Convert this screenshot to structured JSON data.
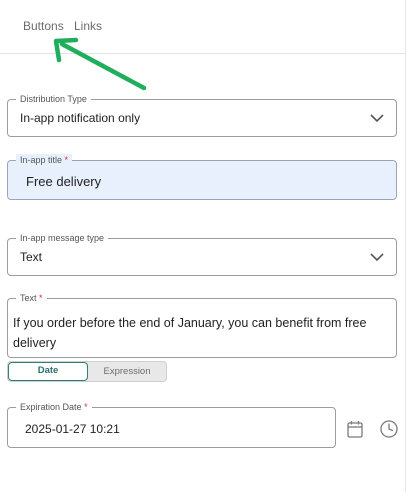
{
  "tabs": [
    {
      "label": "Buttons"
    },
    {
      "label": "Links"
    }
  ],
  "distribution": {
    "label": "Distribution Type",
    "value": "In-app notification only"
  },
  "inapp_title": {
    "label": "In-app title",
    "required_mark": "*",
    "value": "Free delivery"
  },
  "message_type": {
    "label": "In-app message type",
    "value": "Text"
  },
  "text_field": {
    "label": "Text",
    "required_mark": "*",
    "value": "If you order before the end of January, you can benefit from free delivery"
  },
  "mode_toggle": {
    "options": [
      "Date",
      "Expression"
    ],
    "selected": "Date"
  },
  "expiration": {
    "label": "Expiration Date",
    "required_mark": "*",
    "value": "2025-01-27 10:21"
  },
  "icons": {
    "dropdown": "chevron-down-icon",
    "calendar": "calendar-icon",
    "clock": "clock-icon",
    "annotation": "arrow-annotation"
  },
  "colors": {
    "arrow": "#1fae5b",
    "accent": "#2e7d78",
    "required": "#d32f2f",
    "focused_field_bg": "#e8f0fe"
  }
}
